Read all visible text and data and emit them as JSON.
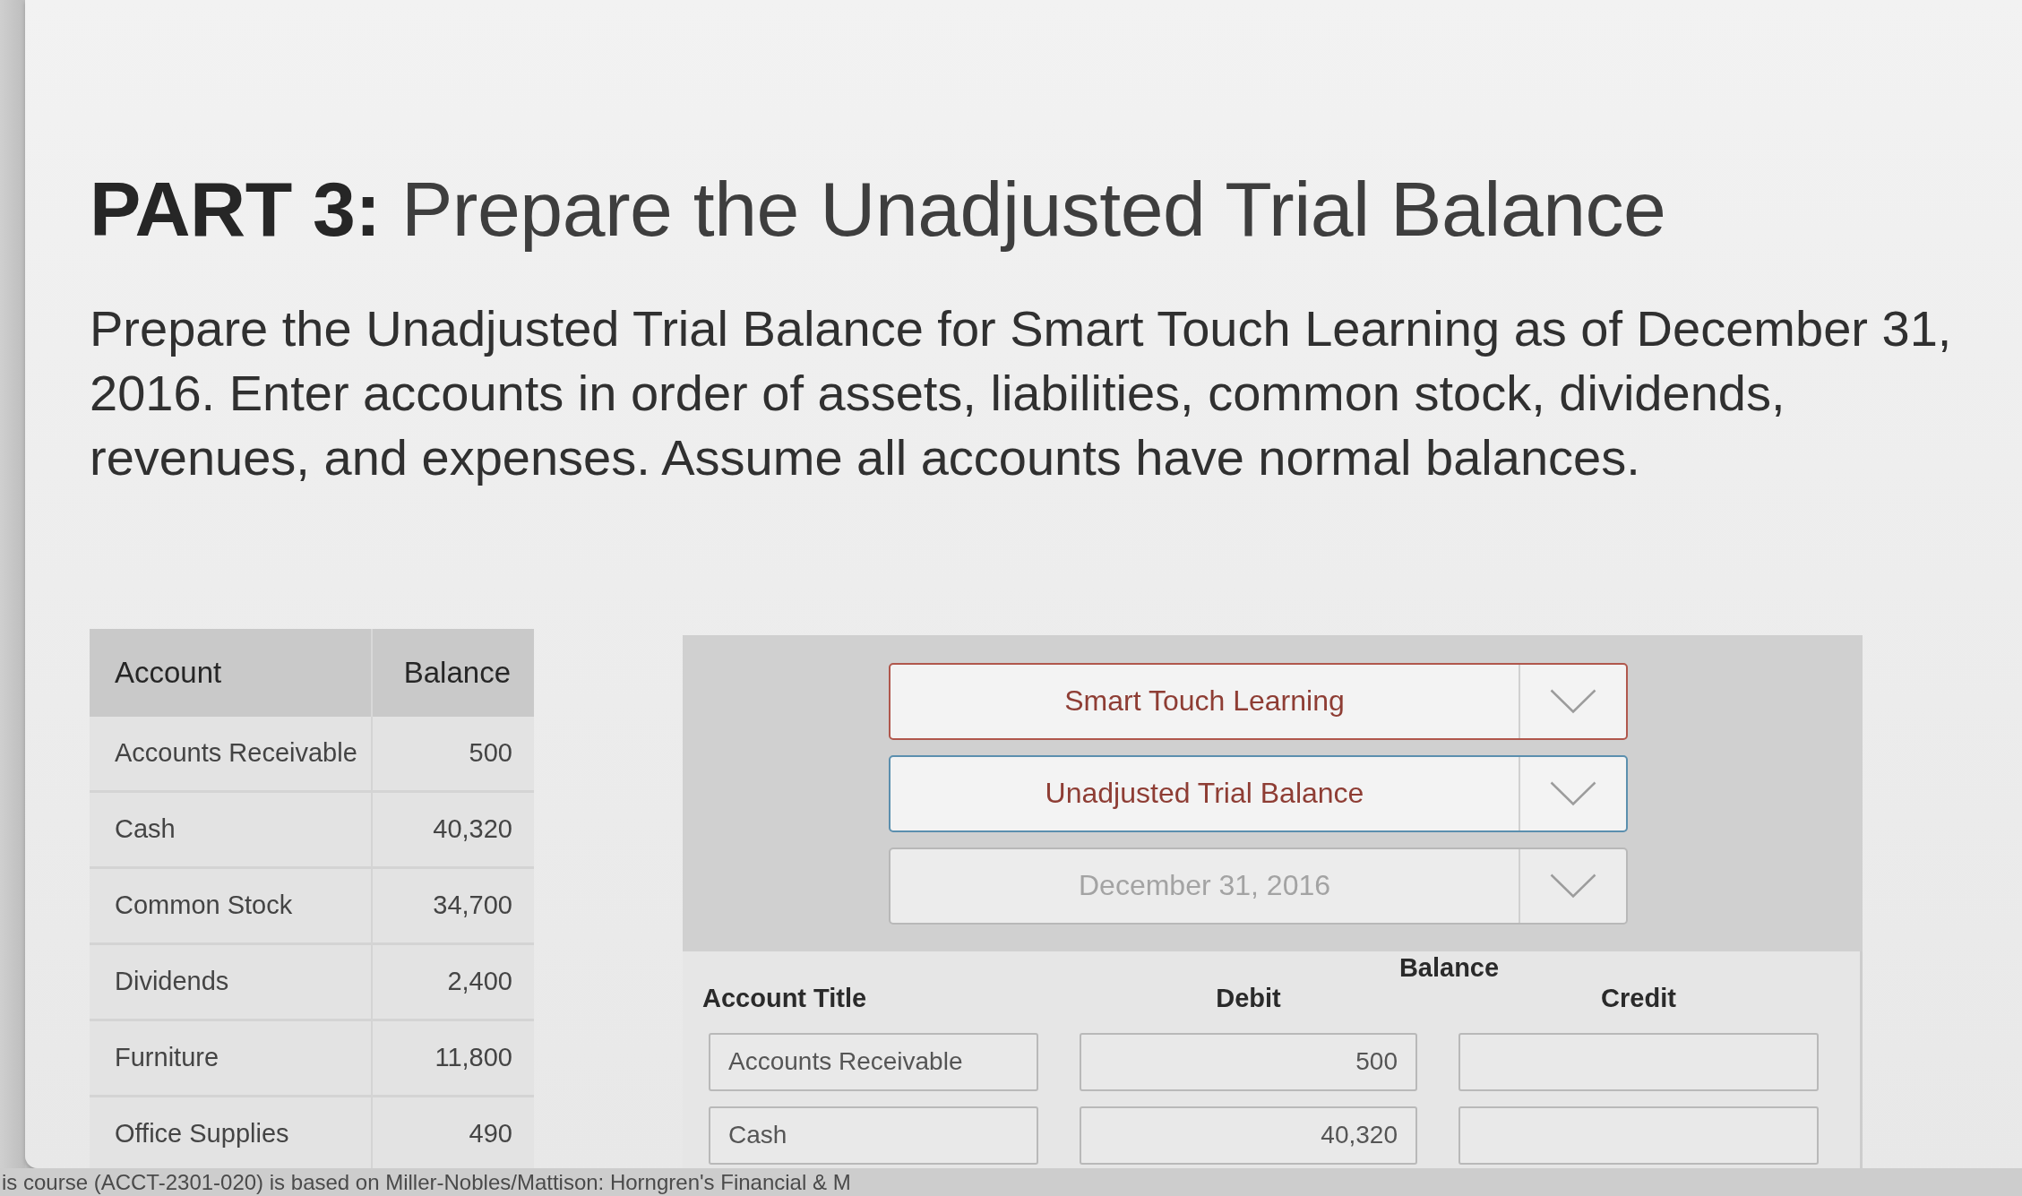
{
  "page": {
    "title": "**PART 3:** Prepare the Unadjusted Trial Balance",
    "instructions": "Prepare the Unadjusted Trial Balance for Smart Touch Learning as of December 31, 2016. Enter accounts in order of assets, liabilities, common stock, dividends, revenues, and expenses. Assume all accounts have normal balances."
  },
  "account_table": {
    "columns": [
      "Account",
      "Balance"
    ],
    "rows": [
      {
        "account": "Accounts Receivable",
        "balance": "500"
      },
      {
        "account": "Cash",
        "balance": "40,320"
      },
      {
        "account": "Common Stock",
        "balance": "34,700"
      },
      {
        "account": "Dividends",
        "balance": "2,400"
      },
      {
        "account": "Furniture",
        "balance": "11,800"
      },
      {
        "account": "Office Supplies",
        "balance": "490"
      }
    ]
  },
  "trial_balance": {
    "dropdowns": [
      {
        "value": "Smart Touch Learning",
        "color": "#b0574c",
        "disabled": false
      },
      {
        "value": "Unadjusted Trial Balance",
        "color": "#5b8fae",
        "disabled": false
      },
      {
        "value": "December 31, 2016",
        "color": "#b8b8b8",
        "disabled": true
      }
    ],
    "group_heading": "Balance",
    "columns": [
      "Account Title",
      "Debit",
      "Credit"
    ],
    "rows": [
      {
        "account_title": "Accounts Receivable",
        "debit": "500"
      },
      {
        "account_title": "Cash",
        "debit": "40,320"
      }
    ]
  },
  "footer": {
    "text": "is course (ACCT-2301-020) is based on Miller-Nobles/Mattison: Horngren's Financial & M"
  }
}
